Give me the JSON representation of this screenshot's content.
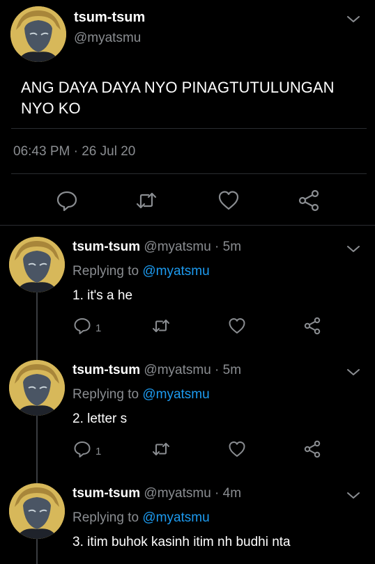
{
  "main_tweet": {
    "display_name": "tsum-tsum",
    "handle": "@myatsmu",
    "text": "ANG DAYA DAYA NYO PINAGTUTULUNGAN NYO KO",
    "timestamp": "06:43 PM · 26 Jul 20",
    "actions": [
      "reply-icon",
      "retweet-icon",
      "like-icon",
      "share-icon"
    ]
  },
  "replies": [
    {
      "display_name": "tsum-tsum",
      "meta": " @myatsmu · 5m",
      "replying_prefix": "Replying to ",
      "replying_to": "@myatsmu",
      "text": "1. it's a he",
      "reply_count": "1"
    },
    {
      "display_name": "tsum-tsum",
      "meta": " @myatsmu · 5m",
      "replying_prefix": "Replying to ",
      "replying_to": "@myatsmu",
      "text": "2. letter s",
      "reply_count": "1"
    },
    {
      "display_name": "tsum-tsum",
      "meta": " @myatsmu · 4m",
      "replying_prefix": "Replying to ",
      "replying_to": "@myatsmu",
      "text": "3. itim buhok kasinh itim nh budhi nta",
      "reply_count": ""
    }
  ],
  "colors": {
    "background": "#000000",
    "secondary_text": "#8a8d91",
    "mention": "#1d9bf0",
    "divider": "#2a2d31"
  }
}
